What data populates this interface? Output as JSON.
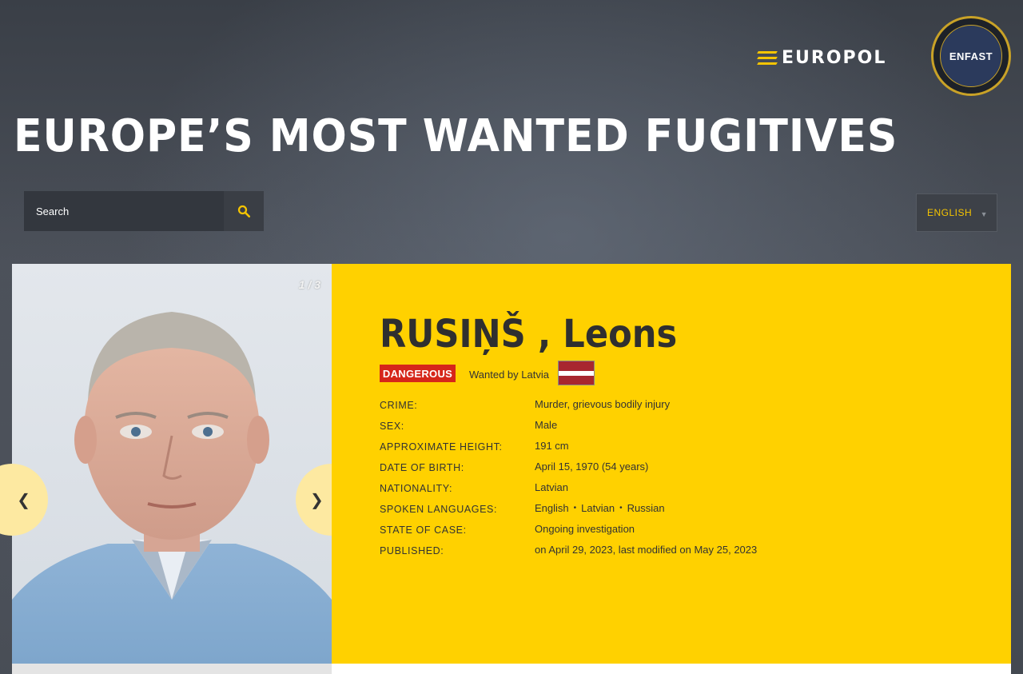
{
  "header": {
    "europol_logo_text": "EUROPOL",
    "enfast_logo_text": "ENFAST",
    "page_title": "EUROPE’S MOST WANTED FUGITIVES"
  },
  "search": {
    "placeholder": "Search"
  },
  "language_selector": {
    "selected": "ENGLISH"
  },
  "carousel": {
    "counter": "1 / 3",
    "prev_label": "❮",
    "next_label": "❯"
  },
  "fugitive": {
    "name": "RUSIŅŠ , Leons",
    "badge": "DANGEROUS",
    "wanted_by": "Wanted by Latvia",
    "flag_colors": [
      "#a8272f",
      "#ffffff",
      "#a8272f"
    ],
    "details": [
      {
        "label": "CRIME:",
        "value": "Murder, grievous bodily injury"
      },
      {
        "label": "SEX:",
        "value": "Male"
      },
      {
        "label": "APPROXIMATE HEIGHT:",
        "value": "191 cm"
      },
      {
        "label": "DATE OF BIRTH:",
        "value": "April 15, 1970 (54 years)"
      },
      {
        "label": "NATIONALITY:",
        "value": "Latvian"
      },
      {
        "label": "SPOKEN LANGUAGES:",
        "languages": [
          "English",
          "Latvian",
          "Russian"
        ]
      },
      {
        "label": "STATE OF CASE:",
        "value": "Ongoing investigation"
      },
      {
        "label": "PUBLISHED:",
        "value": "on April 29, 2023, last modified on May 25, 2023"
      }
    ]
  },
  "colors": {
    "accent_yellow": "#ffd100",
    "danger_red": "#d6261a",
    "lang_text": "#f5c400"
  }
}
